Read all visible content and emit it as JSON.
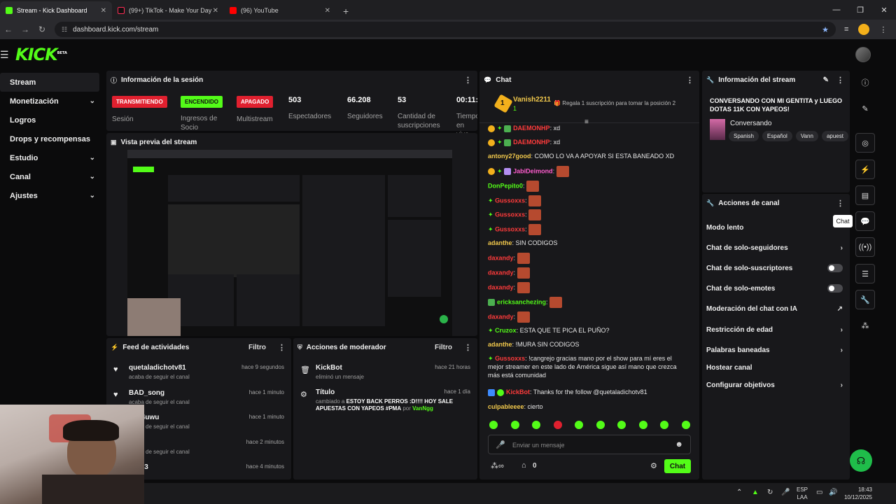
{
  "browser": {
    "tabs": [
      {
        "title": "Stream - Kick Dashboard"
      },
      {
        "title": "(99+) TikTok - Make Your Day"
      },
      {
        "title": "(96) YouTube"
      }
    ],
    "url": "dashboard.kick.com/stream"
  },
  "brand": {
    "logo": "KICK",
    "beta": "BETA",
    "accent": "#53fc18"
  },
  "sidebar": {
    "items": [
      {
        "label": "Stream"
      },
      {
        "label": "Monetización"
      },
      {
        "label": "Logros"
      },
      {
        "label": "Drops y recompensas"
      },
      {
        "label": "Estudio"
      },
      {
        "label": "Canal"
      },
      {
        "label": "Ajustes"
      }
    ]
  },
  "session": {
    "title": "Información de la sesión",
    "badges": [
      "TRANSMITIENDO",
      "ENCENDIDO",
      "APAGADO"
    ],
    "badge_labels": [
      "Sesión",
      "Ingresos de Socio",
      "Multistream"
    ],
    "stats": [
      {
        "value": "503",
        "label": "Espectadores"
      },
      {
        "value": "66.208",
        "label": "Seguidores"
      },
      {
        "value": "53",
        "label": "Cantidad de suscripciones"
      },
      {
        "value": "00:11:",
        "label": "Tiempo en vivo"
      }
    ]
  },
  "preview": {
    "title": "Vista previa del stream"
  },
  "feed": {
    "title": "Feed de actividades",
    "filter": "Filtro",
    "rows": [
      {
        "name": "quetaladichotv81",
        "sub": "acaba de seguir el canal",
        "time": "hace 9 segundos"
      },
      {
        "name": "BAD_song",
        "sub": "acaba de seguir el canal",
        "time": "hace 1 minuto"
      },
      {
        "name": "go64uwu",
        "sub": "acaba de seguir el canal",
        "time": "hace 1 minuto"
      },
      {
        "name": "an",
        "sub": "acaba de seguir el canal",
        "time": "hace 2 minutos"
      },
      {
        "name": "23123",
        "sub": "",
        "time": "hace 4 minutos"
      }
    ]
  },
  "mod": {
    "title": "Acciones de moderador",
    "filter": "Filtro",
    "rows": [
      {
        "name": "KickBot",
        "sub": "eliminó un mensaje",
        "time": "hace 21 horas"
      },
      {
        "name": "Título",
        "sub_pre": "cambiado a",
        "sub_bold": "ESTOY BACK PERROS :D!!!! HOY SALE APUESTAS CON YAPEOS #PMA",
        "sub_by": "por",
        "sub_user": "VanNgg",
        "time": "hace 1 día"
      }
    ]
  },
  "chat": {
    "title": "Chat",
    "pinned_user": "Vanish2211",
    "pinned_count": "1",
    "pinned_rank": "1",
    "sub_prompt": "Regala 1 suscripción para tomar la posición 2",
    "messages": [
      {
        "user": "DAEMONHP",
        "text": "xd",
        "color": "#ff3b3b"
      },
      {
        "user": "DAEMONHP",
        "text": "xd",
        "color": "#ff3b3b"
      },
      {
        "user": "antony27good",
        "text": "COMO LO VA A APOYAR SI ESTA BANEADO XD",
        "color": "#f2c94c"
      },
      {
        "user": "JabiDeimond",
        "text": "",
        "color": "#ff5ccf"
      },
      {
        "user": "DonPepito0",
        "text": "",
        "color": "#53fc18"
      },
      {
        "user": "Gussoxxs",
        "text": "",
        "color": "#ff3b3b"
      },
      {
        "user": "Gussoxxs",
        "text": "",
        "color": "#ff3b3b"
      },
      {
        "user": "Gussoxxs",
        "text": "",
        "color": "#ff3b3b"
      },
      {
        "user": "adanthe",
        "text": "SIN CODIGOS",
        "color": "#f2c94c"
      },
      {
        "user": "daxandy",
        "text": "",
        "color": "#ff3b3b"
      },
      {
        "user": "daxandy",
        "text": "",
        "color": "#ff3b3b"
      },
      {
        "user": "daxandy",
        "text": "",
        "color": "#ff3b3b"
      },
      {
        "user": "ericksanchezing",
        "text": "",
        "color": "#53fc18"
      },
      {
        "user": "daxandy",
        "text": "",
        "color": "#ff3b3b"
      },
      {
        "user": "Cruzox",
        "text": "ESTA QUE TE PICA EL PUÑO?",
        "color": "#53fc18"
      },
      {
        "user": "adanthe",
        "text": "!MURA SIN CODIGOS",
        "color": "#f2c94c"
      },
      {
        "user": "Gussoxxs",
        "text": "!cangrejo gracias mano por el show para mí eres el mejor streamer en este lado de América sigue así mano que crezca más está comunidad",
        "color": "#ff3b3b"
      },
      {
        "user": "KickBot",
        "text": "Thanks for the follow @quetaladichotv81",
        "color": "#ff3b3b"
      },
      {
        "user": "culpableeee",
        "text": "cierto",
        "color": "#f2c94c"
      }
    ],
    "placeholder": "Enviar un mensaje",
    "points": "0",
    "send": "Chat"
  },
  "streaminfo": {
    "title": "Información del stream",
    "stream_title": "CONVERSANDO CON MI GENTITA y LUEGO DOTAS 11K CON YAPEOS!",
    "category": "Conversando",
    "tags": [
      "Spanish",
      "Español",
      "Vann",
      "apuest"
    ]
  },
  "actions": {
    "title": "Acciones de canal",
    "items": [
      {
        "label": "Modo lento",
        "ctl": "none"
      },
      {
        "label": "Chat de solo-seguidores",
        "ctl": "chev"
      },
      {
        "label": "Chat de solo-suscriptores",
        "ctl": "toggle"
      },
      {
        "label": "Chat de solo-emotes",
        "ctl": "toggle"
      },
      {
        "label": "Moderación del chat con IA",
        "ctl": "ext"
      },
      {
        "label": "Restricción de edad",
        "ctl": "chev"
      },
      {
        "label": "Palabras baneadas",
        "ctl": "chev"
      },
      {
        "label": "Hostear canal",
        "ctl": "none"
      },
      {
        "label": "Configurar objetivos",
        "ctl": "chev"
      }
    ],
    "tooltip": "Chat"
  },
  "taskbar": {
    "lang": "ESP",
    "region": "LAA",
    "time": "18:43",
    "date": "10/12/2025"
  }
}
